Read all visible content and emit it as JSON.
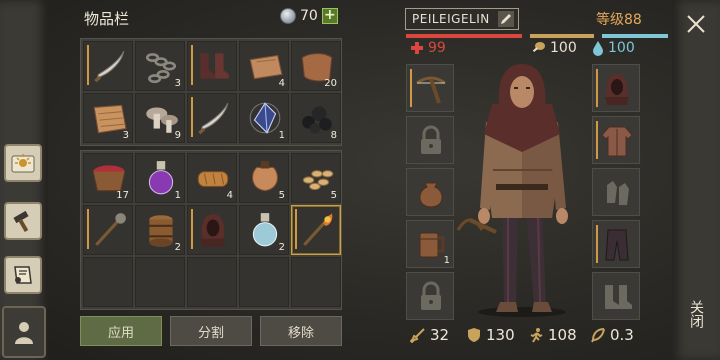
{
  "inventory": {
    "title": "物品栏",
    "coins": "70",
    "plus": "+",
    "slots_top": [
      {
        "icon": "scimitar-icon",
        "count": "",
        "durability": true
      },
      {
        "icon": "chain-icon",
        "count": "3",
        "durability": false
      },
      {
        "icon": "boots-icon",
        "count": "",
        "durability": true
      },
      {
        "icon": "leather-roll-icon",
        "count": "4",
        "durability": false
      },
      {
        "icon": "leather-pelt-icon",
        "count": "20",
        "durability": false
      },
      {
        "icon": "cloth-icon",
        "count": "3",
        "durability": false
      },
      {
        "icon": "mushroom-icon",
        "count": "9",
        "durability": false
      },
      {
        "icon": "scimitar-icon",
        "count": "",
        "durability": true
      },
      {
        "icon": "crystal-icon",
        "count": "1",
        "durability": false
      },
      {
        "icon": "coal-icon",
        "count": "8",
        "durability": false
      }
    ],
    "slots_bottom": [
      {
        "icon": "berry-bowl-icon",
        "count": "17",
        "durability": false
      },
      {
        "icon": "potion-purple-icon",
        "count": "1",
        "durability": false
      },
      {
        "icon": "bread-icon",
        "count": "4",
        "durability": false
      },
      {
        "icon": "flask-icon",
        "count": "5",
        "durability": false
      },
      {
        "icon": "seeds-icon",
        "count": "5",
        "durability": false
      },
      {
        "icon": "mace-icon",
        "count": "",
        "durability": true
      },
      {
        "icon": "barrel-icon",
        "count": "2",
        "durability": false
      },
      {
        "icon": "hood-icon",
        "count": "",
        "durability": true
      },
      {
        "icon": "potion-water-icon",
        "count": "2",
        "durability": false
      },
      {
        "icon": "torch-icon",
        "count": "",
        "durability": true
      },
      {
        "icon": "",
        "count": "",
        "durability": false
      },
      {
        "icon": "",
        "count": "",
        "durability": false
      },
      {
        "icon": "",
        "count": "",
        "durability": false
      },
      {
        "icon": "",
        "count": "",
        "durability": false
      },
      {
        "icon": "",
        "count": "",
        "durability": false
      }
    ],
    "buttons": {
      "apply": "应用",
      "split": "分割",
      "remove": "移除"
    }
  },
  "character": {
    "name": "PEILEIGELIN",
    "level": "等级88",
    "health": "99",
    "hunger": "100",
    "water": "100",
    "colors": {
      "health": "#d9473f",
      "hunger": "#c9a35c",
      "water": "#7fc6d6"
    },
    "left_slots": [
      {
        "icon": "crossbow-icon",
        "count": "",
        "durability": true
      },
      {
        "icon": "lock-icon",
        "count": "",
        "durability": false
      },
      {
        "icon": "pouch-icon",
        "count": "",
        "durability": false
      },
      {
        "icon": "mug-icon",
        "count": "1",
        "durability": false
      },
      {
        "icon": "lock-icon",
        "count": "",
        "durability": false
      }
    ],
    "right_slots": [
      {
        "icon": "hood-icon",
        "count": "",
        "durability": true
      },
      {
        "icon": "jacket-icon",
        "count": "",
        "durability": true
      },
      {
        "icon": "gloves-icon",
        "count": "",
        "durability": false
      },
      {
        "icon": "pants-icon",
        "count": "",
        "durability": true
      },
      {
        "icon": "boots-icon",
        "count": "",
        "durability": false
      }
    ],
    "stats": {
      "attack": "32",
      "defense": "130",
      "speed": "108",
      "weight": "0.3"
    }
  },
  "close": {
    "label": "关闭"
  }
}
